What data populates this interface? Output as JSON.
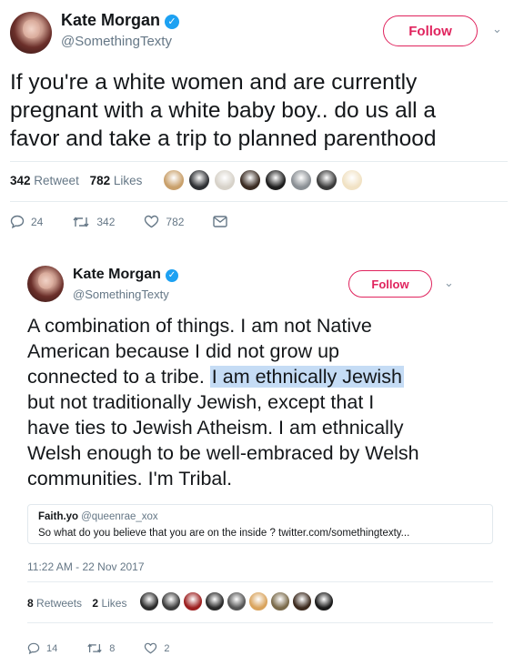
{
  "tweet1": {
    "name": "Kate Morgan",
    "handle": "@SomethingTexty",
    "follow_label": "Follow",
    "text_lines": [
      "If you're a white women and are currently",
      "pregnant with a white baby boy.. do us all a",
      "favor and take a trip to planned parenthood"
    ],
    "retweet_count": "342",
    "retweet_label": "Retweet",
    "like_count": "782",
    "like_label": "Likes",
    "reply_count": "24",
    "retweet_action_count": "342",
    "like_action_count": "782",
    "liker_avatar_colors": [
      "#c9a06b",
      "#2d2f33",
      "#d7d2c9",
      "#3a2b22",
      "#1e1e1e",
      "#8a8f94",
      "#3a3a3a",
      "#f1e2c4"
    ]
  },
  "tweet2": {
    "name": "Kate Morgan",
    "handle": "@SomethingTexty",
    "follow_label": "Follow",
    "text_lines": [
      "A combination of things. I am not Native",
      "American because I did not grow up"
    ],
    "line3_before": "connected to a tribe. ",
    "line3_highlight": "I am ethnically Jewish",
    "text_lines_after": [
      "but not traditionally Jewish, except that I",
      "have ties to Jewish Atheism. I am ethnically",
      "Welsh enough to be well-embraced by Welsh",
      "communities. I'm Tribal."
    ],
    "quote": {
      "name": "Faith.yo",
      "handle": "@queenrae_xox",
      "text": "So what do you believe that you are on the inside ? twitter.com/somethingtexty..."
    },
    "timestamp": "11:22 AM - 22 Nov 2017",
    "retweet_count": "8",
    "retweet_label": "Retweets",
    "like_count": "2",
    "like_label": "Likes",
    "reply_count": "14",
    "retweet_action_count": "8",
    "like_action_count": "2",
    "liker_avatar_colors": [
      "#2b2b2b",
      "#3d3d3d",
      "#9c1f1f",
      "#2a2a2a",
      "#555555",
      "#d9a35c",
      "#7a6a4a",
      "#3c2a1e",
      "#1a1a1a"
    ]
  },
  "colors": {
    "accent": "#1da1f2",
    "follow": "#e0245e",
    "secondary_text": "#657786",
    "highlight": "#c5dcf5"
  }
}
